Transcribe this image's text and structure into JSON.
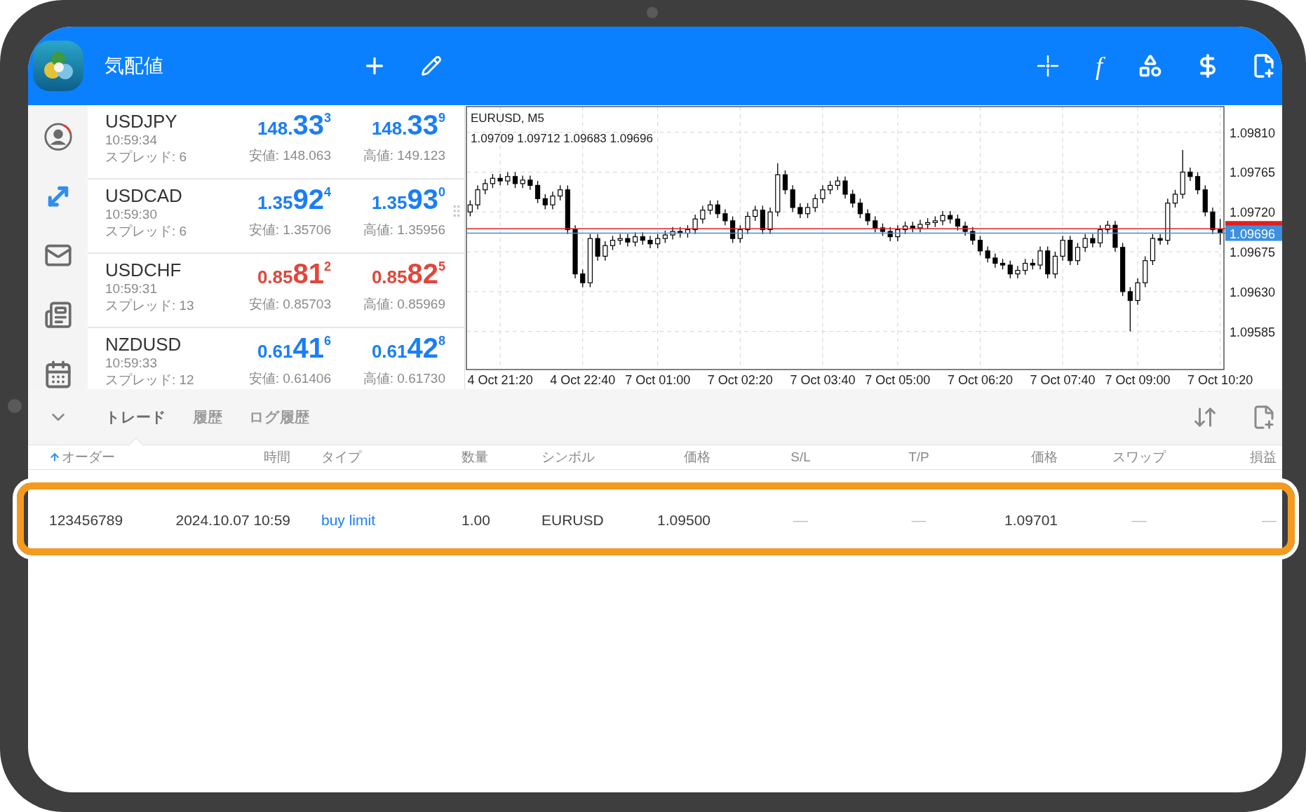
{
  "app_bar": {
    "title": "気配値",
    "indicator_label": "f"
  },
  "quotes": [
    {
      "symbol": "USDJPY",
      "time": "10:59:34",
      "spread": "スプレッド: 6",
      "bid": {
        "prefix": "148.",
        "big": "33",
        "sup": "3"
      },
      "ask": {
        "prefix": "148.",
        "big": "33",
        "sup": "9"
      },
      "low": "安値: 148.063",
      "high": "高値: 149.123",
      "color": "#1a7ef5"
    },
    {
      "symbol": "USDCAD",
      "time": "10:59:30",
      "spread": "スプレッド: 6",
      "bid": {
        "prefix": "1.35",
        "big": "92",
        "sup": "4"
      },
      "ask": {
        "prefix": "1.35",
        "big": "93",
        "sup": "0"
      },
      "low": "安値: 1.35706",
      "high": "高値: 1.35956",
      "color": "#1a7ef5"
    },
    {
      "symbol": "USDCHF",
      "time": "10:59:31",
      "spread": "スプレッド: 13",
      "bid": {
        "prefix": "0.85",
        "big": "81",
        "sup": "2"
      },
      "ask": {
        "prefix": "0.85",
        "big": "82",
        "sup": "5"
      },
      "low": "安値: 0.85703",
      "high": "高値: 0.85969",
      "color": "#e0473c"
    },
    {
      "symbol": "NZDUSD",
      "time": "10:59:33",
      "spread": "スプレッド: 12",
      "bid": {
        "prefix": "0.61",
        "big": "41",
        "sup": "6"
      },
      "ask": {
        "prefix": "0.61",
        "big": "42",
        "sup": "8"
      },
      "low": "安値: 0.61406",
      "high": "高値: 0.61730",
      "color": "#1a7ef5"
    }
  ],
  "chart": {
    "ohlc_label": "1.09709 1.09712 1.09683 1.09696",
    "chart_data": {
      "type": "candlestick",
      "title": "EURUSD, M5",
      "grid": true,
      "categories": [
        null,
        null,
        null,
        null,
        "4 Oct 21:20",
        null,
        null,
        null,
        null,
        null,
        null,
        null,
        null,
        null,
        null,
        "4 Oct 22:40",
        null,
        null,
        null,
        null,
        null,
        null,
        null,
        null,
        null,
        "7 Oct 01:00",
        null,
        null,
        null,
        null,
        null,
        null,
        null,
        null,
        null,
        null,
        "7 Oct 02:20",
        null,
        null,
        null,
        null,
        null,
        null,
        null,
        null,
        null,
        null,
        "7 Oct 03:40",
        null,
        null,
        null,
        null,
        null,
        null,
        null,
        null,
        null,
        "7 Oct 05:00",
        null,
        null,
        null,
        null,
        null,
        null,
        null,
        null,
        null,
        null,
        "7 Oct 06:20",
        null,
        null,
        null,
        null,
        null,
        null,
        null,
        null,
        null,
        null,
        "7 Oct 07:40",
        null,
        null,
        null,
        null,
        null,
        null,
        null,
        null,
        null,
        "7 Oct 09:00",
        null,
        null,
        null,
        null,
        null,
        null,
        null,
        null,
        null,
        null,
        "7 Oct 10:20"
      ],
      "ohlc": [
        [
          1.0972,
          1.09733,
          1.09715,
          1.09728
        ],
        [
          1.09728,
          1.0975,
          1.09723,
          1.09745
        ],
        [
          1.09745,
          1.09757,
          1.0974,
          1.09752
        ],
        [
          1.09752,
          1.09763,
          1.09747,
          1.09758
        ],
        [
          1.09758,
          1.09763,
          1.0975,
          1.09755
        ],
        [
          1.09755,
          1.09765,
          1.0975,
          1.0976
        ],
        [
          1.0976,
          1.09765,
          1.09747,
          1.09752
        ],
        [
          1.09752,
          1.09761,
          1.09747,
          1.09756
        ],
        [
          1.09756,
          1.09761,
          1.09745,
          1.0975
        ],
        [
          1.0975,
          1.09755,
          1.0973,
          1.09735
        ],
        [
          1.09735,
          1.0974,
          1.09723,
          1.09728
        ],
        [
          1.09728,
          1.09743,
          1.09723,
          1.09738
        ],
        [
          1.09738,
          1.0975,
          1.09733,
          1.09745
        ],
        [
          1.09745,
          1.0975,
          1.09695,
          1.097
        ],
        [
          1.097,
          1.09705,
          1.09645,
          1.0965
        ],
        [
          1.0965,
          1.09655,
          1.09635,
          1.0964
        ],
        [
          1.0964,
          1.09695,
          1.09635,
          1.0969
        ],
        [
          1.0969,
          1.09695,
          1.09665,
          1.0967
        ],
        [
          1.0967,
          1.09687,
          1.09665,
          1.09682
        ],
        [
          1.09682,
          1.09693,
          1.09677,
          1.09688
        ],
        [
          1.09688,
          1.09695,
          1.09683,
          1.0969
        ],
        [
          1.0969,
          1.09695,
          1.09681,
          1.09686
        ],
        [
          1.09686,
          1.09697,
          1.09681,
          1.09692
        ],
        [
          1.09692,
          1.09697,
          1.09683,
          1.09688
        ],
        [
          1.09688,
          1.09693,
          1.09679,
          1.09684
        ],
        [
          1.09684,
          1.09695,
          1.09679,
          1.0969
        ],
        [
          1.0969,
          1.09699,
          1.09685,
          1.09694
        ],
        [
          1.09694,
          1.09703,
          1.09689,
          1.09698
        ],
        [
          1.09698,
          1.09703,
          1.09691,
          1.09696
        ],
        [
          1.09696,
          1.09705,
          1.09691,
          1.097
        ],
        [
          1.097,
          1.09717,
          1.09695,
          1.09712
        ],
        [
          1.09712,
          1.09727,
          1.09707,
          1.09722
        ],
        [
          1.09722,
          1.09733,
          1.09717,
          1.09728
        ],
        [
          1.09728,
          1.09733,
          1.09713,
          1.09718
        ],
        [
          1.09718,
          1.09723,
          1.09705,
          1.0971
        ],
        [
          1.0971,
          1.09715,
          1.09685,
          1.0969
        ],
        [
          1.0969,
          1.09705,
          1.09685,
          1.097
        ],
        [
          1.097,
          1.0972,
          1.09695,
          1.09715
        ],
        [
          1.09715,
          1.09727,
          1.0971,
          1.09722
        ],
        [
          1.09722,
          1.09727,
          1.09695,
          1.097
        ],
        [
          1.097,
          1.09725,
          1.09695,
          1.0972
        ],
        [
          1.0972,
          1.09775,
          1.09715,
          1.09762
        ],
        [
          1.09762,
          1.09767,
          1.0974,
          1.09745
        ],
        [
          1.09745,
          1.0975,
          1.0972,
          1.09725
        ],
        [
          1.09725,
          1.0973,
          1.09713,
          1.09718
        ],
        [
          1.09718,
          1.0973,
          1.09713,
          1.09725
        ],
        [
          1.09725,
          1.0974,
          1.0972,
          1.09735
        ],
        [
          1.09735,
          1.0975,
          1.0973,
          1.09745
        ],
        [
          1.09745,
          1.09755,
          1.0974,
          1.0975
        ],
        [
          1.0975,
          1.0976,
          1.09745,
          1.09755
        ],
        [
          1.09755,
          1.0976,
          1.09735,
          1.0974
        ],
        [
          1.0974,
          1.09745,
          1.09725,
          1.0973
        ],
        [
          1.0973,
          1.09735,
          1.09713,
          1.09718
        ],
        [
          1.09718,
          1.09723,
          1.09705,
          1.0971
        ],
        [
          1.0971,
          1.09715,
          1.09697,
          1.09702
        ],
        [
          1.09702,
          1.09707,
          1.09693,
          1.09698
        ],
        [
          1.09698,
          1.09703,
          1.09687,
          1.09692
        ],
        [
          1.09692,
          1.09705,
          1.09687,
          1.097
        ],
        [
          1.097,
          1.09709,
          1.09695,
          1.09704
        ],
        [
          1.09704,
          1.09709,
          1.09697,
          1.09702
        ],
        [
          1.09702,
          1.09711,
          1.09697,
          1.09706
        ],
        [
          1.09706,
          1.09713,
          1.09701,
          1.09708
        ],
        [
          1.09708,
          1.09715,
          1.09703,
          1.0971
        ],
        [
          1.0971,
          1.09721,
          1.09705,
          1.09716
        ],
        [
          1.09716,
          1.09721,
          1.09707,
          1.09712
        ],
        [
          1.09712,
          1.09717,
          1.09699,
          1.09704
        ],
        [
          1.09704,
          1.09709,
          1.09693,
          1.09698
        ],
        [
          1.09698,
          1.09703,
          1.09683,
          1.09688
        ],
        [
          1.09688,
          1.09693,
          1.09671,
          1.09676
        ],
        [
          1.09676,
          1.09681,
          1.09663,
          1.09668
        ],
        [
          1.09668,
          1.09673,
          1.09657,
          1.09662
        ],
        [
          1.09662,
          1.09667,
          1.09655,
          1.0966
        ],
        [
          1.0966,
          1.09665,
          1.09645,
          1.0965
        ],
        [
          1.0965,
          1.09659,
          1.09645,
          1.09654
        ],
        [
          1.09654,
          1.09667,
          1.09649,
          1.09662
        ],
        [
          1.09662,
          1.09667,
          1.09655,
          1.0966
        ],
        [
          1.0966,
          1.09681,
          1.09655,
          1.09676
        ],
        [
          1.09676,
          1.09681,
          1.09645,
          1.0965
        ],
        [
          1.0965,
          1.09675,
          1.09645,
          1.0967
        ],
        [
          1.0967,
          1.09693,
          1.09665,
          1.09688
        ],
        [
          1.09688,
          1.09693,
          1.0966,
          1.09665
        ],
        [
          1.09665,
          1.09685,
          1.0966,
          1.0968
        ],
        [
          1.0968,
          1.09695,
          1.09675,
          1.0969
        ],
        [
          1.0969,
          1.09695,
          1.0968,
          1.09685
        ],
        [
          1.09685,
          1.09705,
          1.0968,
          1.097
        ],
        [
          1.097,
          1.0971,
          1.09695,
          1.09705
        ],
        [
          1.09705,
          1.0971,
          1.09675,
          1.0968
        ],
        [
          1.0968,
          1.09685,
          1.09625,
          1.0963
        ],
        [
          1.0963,
          1.09635,
          1.09585,
          1.0962
        ],
        [
          1.0962,
          1.09645,
          1.09615,
          1.0964
        ],
        [
          1.0964,
          1.0967,
          1.09635,
          1.09665
        ],
        [
          1.09665,
          1.09695,
          1.0966,
          1.0969
        ],
        [
          1.0969,
          1.09695,
          1.09683,
          1.09688
        ],
        [
          1.09688,
          1.09735,
          1.09683,
          1.0973
        ],
        [
          1.0973,
          1.09745,
          1.09725,
          1.0974
        ],
        [
          1.0974,
          1.0979,
          1.09735,
          1.09765
        ],
        [
          1.09765,
          1.0977,
          1.09755,
          1.0976
        ],
        [
          1.0976,
          1.09765,
          1.0974,
          1.09745
        ],
        [
          1.09745,
          1.0975,
          1.09715,
          1.0972
        ],
        [
          1.0972,
          1.09725,
          1.09695,
          1.097
        ],
        [
          1.097,
          1.09712,
          1.09683,
          1.09696
        ]
      ],
      "ylim": [
        1.09542,
        1.09839
      ],
      "yticks": [
        {
          "value": 1.0981,
          "label": "1.09810"
        },
        {
          "value": 1.09765,
          "label": "1.09765"
        },
        {
          "value": 1.0972,
          "label": "1.09720"
        },
        {
          "value": 1.09675,
          "label": "1.09675"
        },
        {
          "value": 1.0963,
          "label": "1.09630"
        },
        {
          "value": 1.09585,
          "label": "1.09585"
        }
      ],
      "ref_lines": [
        {
          "axis": "y",
          "value": 1.09701,
          "color": "#e02020"
        },
        {
          "axis": "y",
          "value": 1.09696,
          "color": "#3d8fe0",
          "label": "1.09696"
        }
      ]
    }
  },
  "tabs": [
    {
      "label": "トレード",
      "selected": true
    },
    {
      "label": "履歴",
      "selected": false
    },
    {
      "label": "ログ履歴",
      "selected": false
    }
  ],
  "columns": [
    {
      "label": "オーダー",
      "sorted": true
    },
    {
      "label": "時間",
      "sorted": false
    },
    {
      "label": "タイプ",
      "sorted": false
    },
    {
      "label": "数量",
      "sorted": false
    },
    {
      "label": "シンボル",
      "sorted": false
    },
    {
      "label": "価格",
      "sorted": false
    },
    {
      "label": "S/L",
      "sorted": false
    },
    {
      "label": "T/P",
      "sorted": false
    },
    {
      "label": "価格",
      "sorted": false
    },
    {
      "label": "スワップ",
      "sorted": false
    },
    {
      "label": "損益",
      "sorted": false
    }
  ],
  "orders": [
    {
      "cells": [
        "123456789",
        "2024.10.07 10:59",
        "buy limit",
        "1.00",
        "EURUSD",
        "1.09500",
        "—",
        "—",
        "1.09701",
        "—",
        "—"
      ],
      "highlighted": true
    }
  ]
}
